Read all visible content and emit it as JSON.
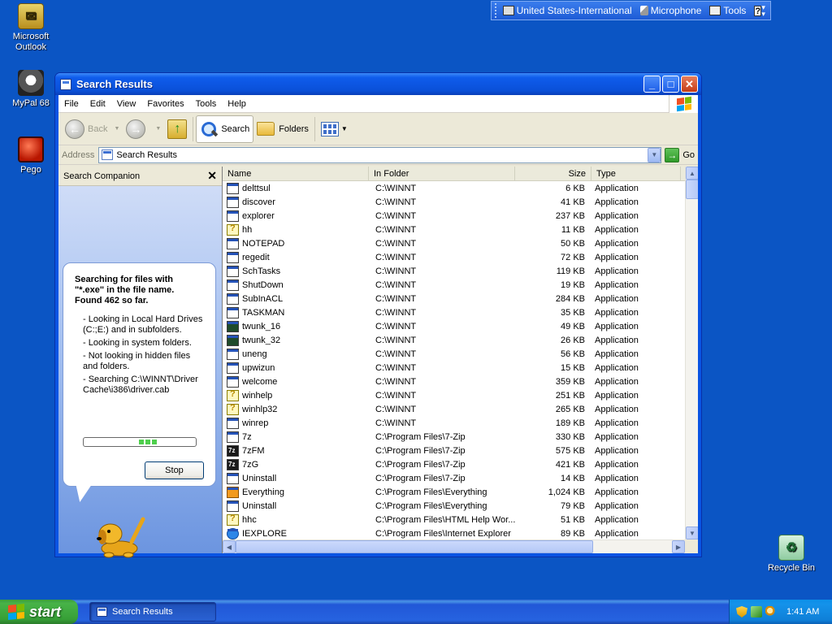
{
  "desktop": {
    "icons": [
      {
        "label": "Microsoft Outlook",
        "icon": "outlook-icon"
      },
      {
        "label": "MyPal 68",
        "icon": "mypal-icon"
      },
      {
        "label": "Pego",
        "icon": "pego-icon"
      },
      {
        "label": "Recycle Bin",
        "icon": "recycle-bin-icon"
      }
    ]
  },
  "langbar": {
    "language": "United States-International",
    "microphone": "Microphone",
    "tools": "Tools",
    "help": "?"
  },
  "window": {
    "title": "Search Results",
    "minimize": "_",
    "maximize": "□",
    "close": "✕"
  },
  "menu": {
    "file": "File",
    "edit": "Edit",
    "view": "View",
    "favorites": "Favorites",
    "tools": "Tools",
    "help": "Help"
  },
  "toolbar": {
    "back": "Back",
    "search": "Search",
    "folders": "Folders"
  },
  "address": {
    "label": "Address",
    "value": "Search Results",
    "go": "Go"
  },
  "companion": {
    "title": "Search Companion",
    "close": "✕",
    "status_line1": "Searching for files with",
    "status_line2": "\"*.exe\" in the file name.",
    "status_line3": "Found 462 so far.",
    "details": [
      "- Looking in Local Hard Drives (C:;E:) and in subfolders.",
      "- Looking in system folders.",
      "- Not looking in hidden files and folders.",
      "- Searching C:\\WINNT\\Driver Cache\\i386\\driver.cab"
    ],
    "stop": "Stop"
  },
  "list": {
    "columns": {
      "name": "Name",
      "folder": "In Folder",
      "size": "Size",
      "type": "Type"
    },
    "rows": [
      {
        "name": "delttsul",
        "folder": "C:\\WINNT",
        "size": "6 KB",
        "type": "Application",
        "icon": "app"
      },
      {
        "name": "discover",
        "folder": "C:\\WINNT",
        "size": "41 KB",
        "type": "Application",
        "icon": "app"
      },
      {
        "name": "explorer",
        "folder": "C:\\WINNT",
        "size": "237 KB",
        "type": "Application",
        "icon": "app"
      },
      {
        "name": "hh",
        "folder": "C:\\WINNT",
        "size": "11 KB",
        "type": "Application",
        "icon": "help"
      },
      {
        "name": "NOTEPAD",
        "folder": "C:\\WINNT",
        "size": "50 KB",
        "type": "Application",
        "icon": "app"
      },
      {
        "name": "regedit",
        "folder": "C:\\WINNT",
        "size": "72 KB",
        "type": "Application",
        "icon": "app"
      },
      {
        "name": "SchTasks",
        "folder": "C:\\WINNT",
        "size": "119 KB",
        "type": "Application",
        "icon": "app"
      },
      {
        "name": "ShutDown",
        "folder": "C:\\WINNT",
        "size": "19 KB",
        "type": "Application",
        "icon": "app"
      },
      {
        "name": "SubInACL",
        "folder": "C:\\WINNT",
        "size": "284 KB",
        "type": "Application",
        "icon": "app"
      },
      {
        "name": "TASKMAN",
        "folder": "C:\\WINNT",
        "size": "35 KB",
        "type": "Application",
        "icon": "app"
      },
      {
        "name": "twunk_16",
        "folder": "C:\\WINNT",
        "size": "49 KB",
        "type": "Application",
        "icon": "green"
      },
      {
        "name": "twunk_32",
        "folder": "C:\\WINNT",
        "size": "26 KB",
        "type": "Application",
        "icon": "green"
      },
      {
        "name": "uneng",
        "folder": "C:\\WINNT",
        "size": "56 KB",
        "type": "Application",
        "icon": "app"
      },
      {
        "name": "upwizun",
        "folder": "C:\\WINNT",
        "size": "15 KB",
        "type": "Application",
        "icon": "app"
      },
      {
        "name": "welcome",
        "folder": "C:\\WINNT",
        "size": "359 KB",
        "type": "Application",
        "icon": "app"
      },
      {
        "name": "winhelp",
        "folder": "C:\\WINNT",
        "size": "251 KB",
        "type": "Application",
        "icon": "help"
      },
      {
        "name": "winhlp32",
        "folder": "C:\\WINNT",
        "size": "265 KB",
        "type": "Application",
        "icon": "help"
      },
      {
        "name": "winrep",
        "folder": "C:\\WINNT",
        "size": "189 KB",
        "type": "Application",
        "icon": "app"
      },
      {
        "name": "7z",
        "folder": "C:\\Program Files\\7-Zip",
        "size": "330 KB",
        "type": "Application",
        "icon": "app"
      },
      {
        "name": "7zFM",
        "folder": "C:\\Program Files\\7-Zip",
        "size": "575 KB",
        "type": "Application",
        "icon": "sevenz"
      },
      {
        "name": "7zG",
        "folder": "C:\\Program Files\\7-Zip",
        "size": "421 KB",
        "type": "Application",
        "icon": "sevenz"
      },
      {
        "name": "Uninstall",
        "folder": "C:\\Program Files\\7-Zip",
        "size": "14 KB",
        "type": "Application",
        "icon": "app"
      },
      {
        "name": "Everything",
        "folder": "C:\\Program Files\\Everything",
        "size": "1,024 KB",
        "type": "Application",
        "icon": "everything"
      },
      {
        "name": "Uninstall",
        "folder": "C:\\Program Files\\Everything",
        "size": "79 KB",
        "type": "Application",
        "icon": "app"
      },
      {
        "name": "hhc",
        "folder": "C:\\Program Files\\HTML Help Wor...",
        "size": "51 KB",
        "type": "Application",
        "icon": "help"
      },
      {
        "name": "IEXPLORE",
        "folder": "C:\\Program Files\\Internet Explorer",
        "size": "89 KB",
        "type": "Application",
        "icon": "ie"
      }
    ]
  },
  "taskbar": {
    "start": "start",
    "task": "Search Results",
    "clock": "1:41 AM"
  }
}
